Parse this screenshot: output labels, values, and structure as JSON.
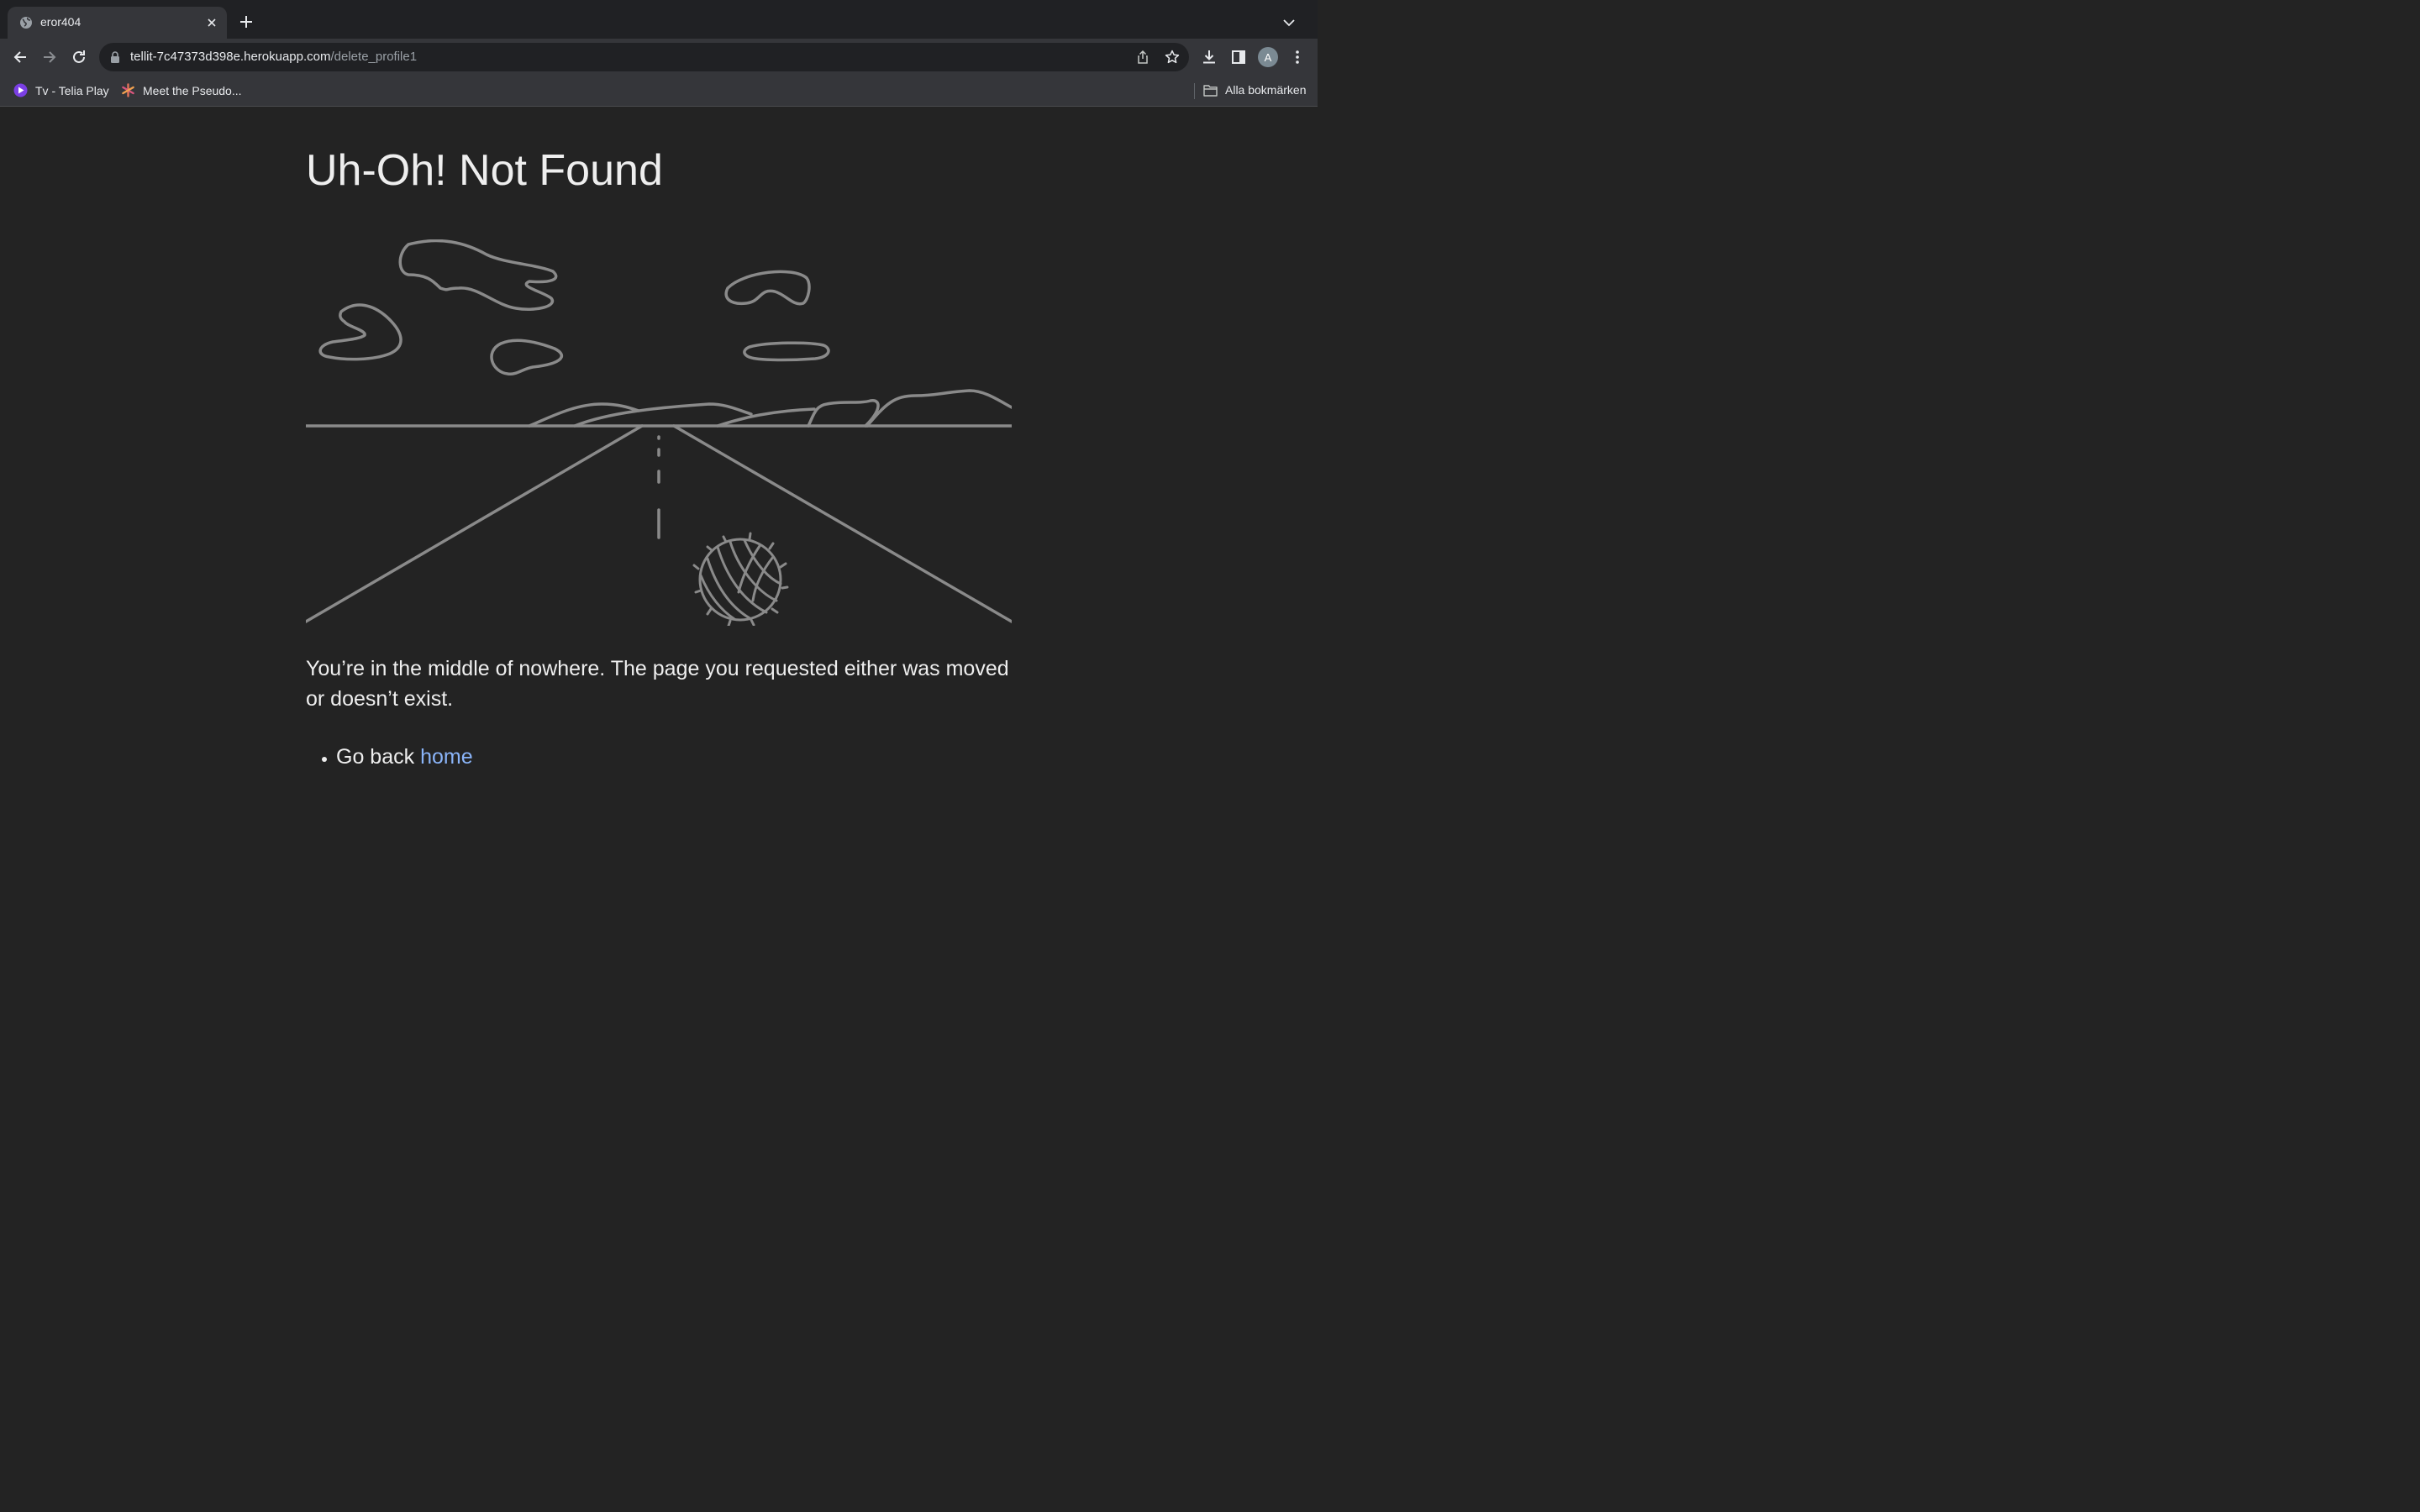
{
  "browser": {
    "tab": {
      "title": "eror404",
      "favicon": "globe-icon"
    },
    "omnibox": {
      "url_host": "tellit-7c47373d398e.herokuapp.com",
      "url_path": "/delete_profile1"
    },
    "profile_initial": "A",
    "bookmarks": [
      {
        "label": "Tv - Telia Play",
        "icon": "telia-play-icon"
      },
      {
        "label": "Meet the Pseudo...",
        "icon": "asterisk-icon"
      }
    ],
    "all_bookmarks_label": "Alla bokmärken"
  },
  "page": {
    "title": "Uh-Oh! Not Found",
    "message": "You’re in the middle of nowhere. The page you requested either was moved or doesn’t exist.",
    "link_prefix": "Go back",
    "link_text": "home",
    "illustration": "desert-road-tumbleweed",
    "link_color": "#8ab4f8"
  }
}
